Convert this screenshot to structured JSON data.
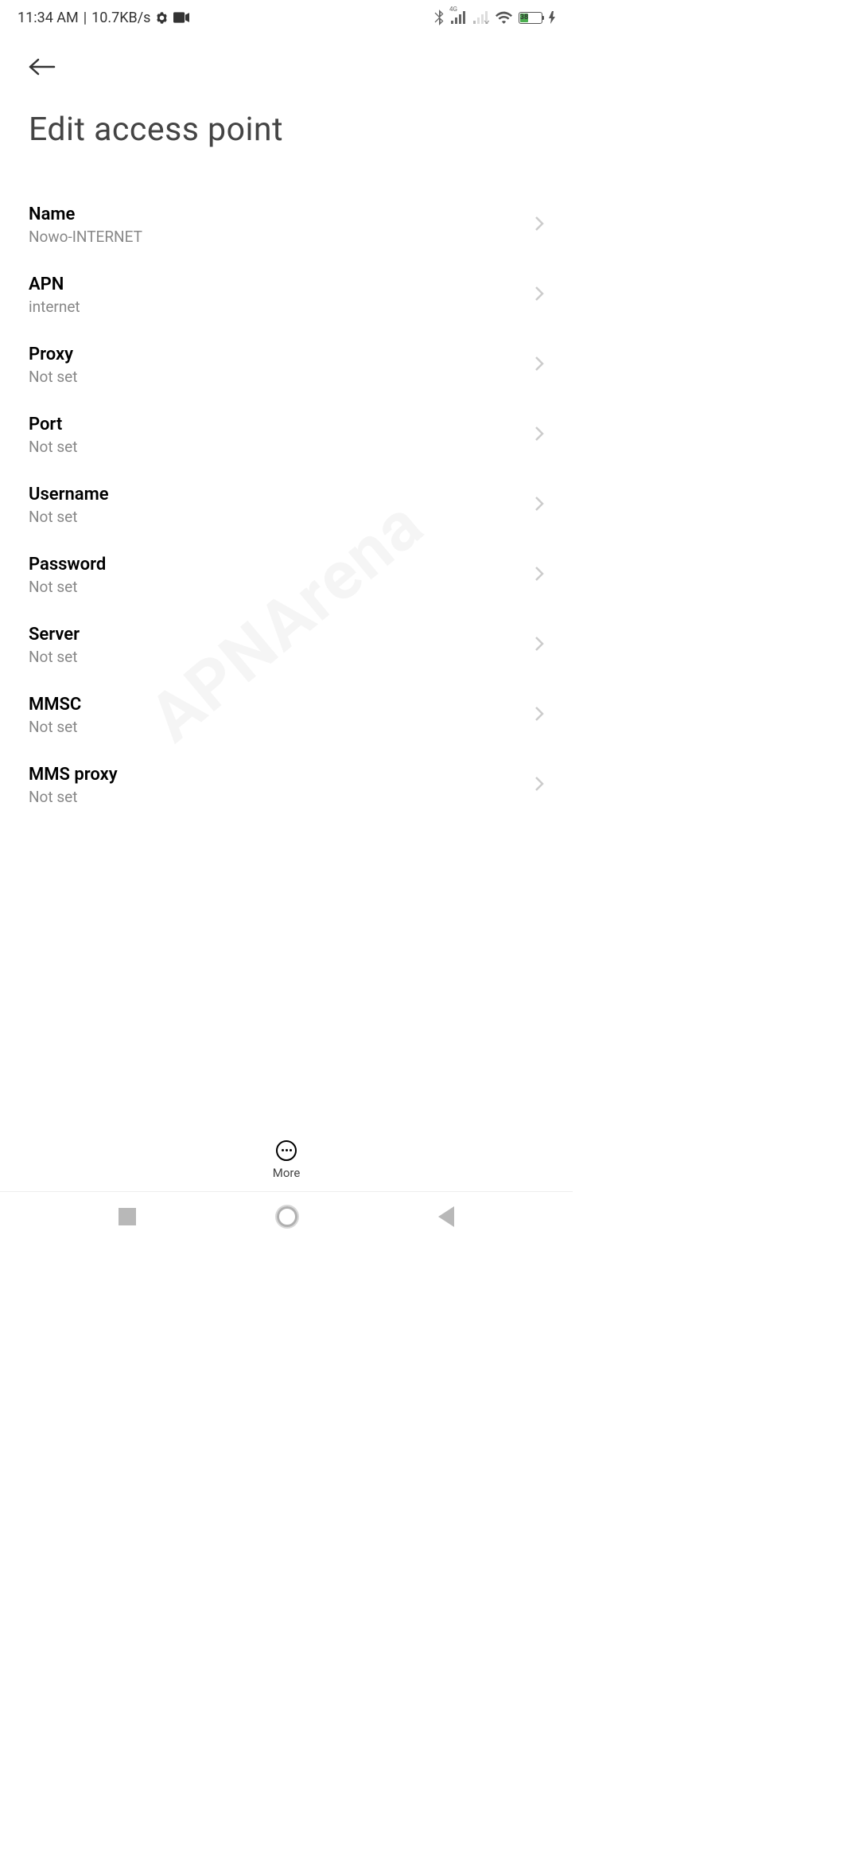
{
  "status_bar": {
    "time": "11:34 AM",
    "separator": "|",
    "data_speed": "10.7KB/s",
    "battery_percent": "38",
    "network_type": "4G"
  },
  "page": {
    "title": "Edit access point"
  },
  "settings": [
    {
      "label": "Name",
      "value": "Nowo-INTERNET"
    },
    {
      "label": "APN",
      "value": "internet"
    },
    {
      "label": "Proxy",
      "value": "Not set"
    },
    {
      "label": "Port",
      "value": "Not set"
    },
    {
      "label": "Username",
      "value": "Not set"
    },
    {
      "label": "Password",
      "value": "Not set"
    },
    {
      "label": "Server",
      "value": "Not set"
    },
    {
      "label": "MMSC",
      "value": "Not set"
    },
    {
      "label": "MMS proxy",
      "value": "Not set"
    }
  ],
  "bottom_bar": {
    "more_label": "More"
  },
  "watermark": "APNArena"
}
